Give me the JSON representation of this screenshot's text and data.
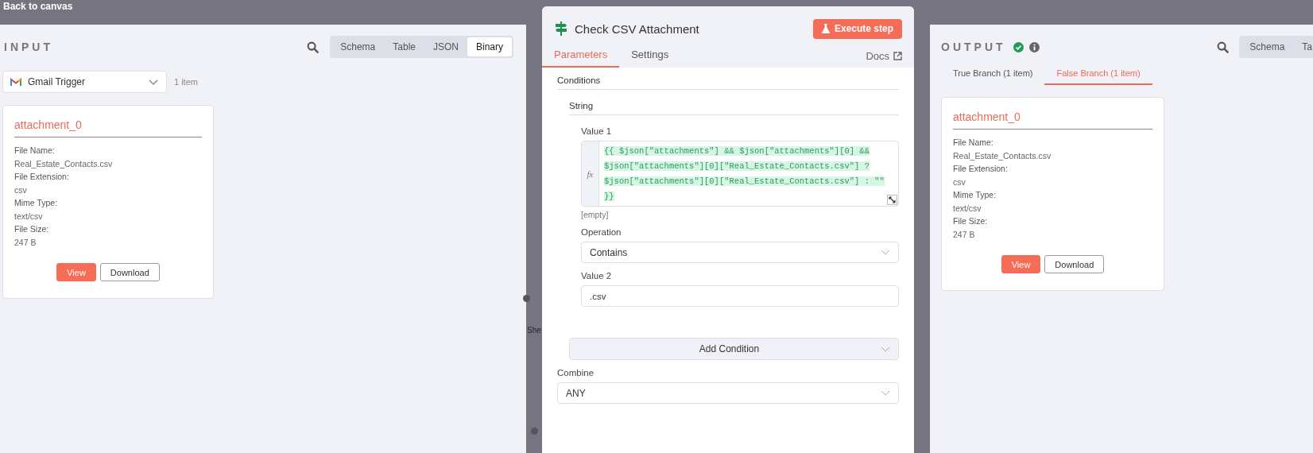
{
  "top_bar": {
    "back_link": "Back to canvas"
  },
  "input_panel": {
    "title": "INPUT",
    "view_tabs": [
      {
        "label": "Schema",
        "selected": false
      },
      {
        "label": "Table",
        "selected": false
      },
      {
        "label": "JSON",
        "selected": false
      },
      {
        "label": "Binary",
        "selected": true
      }
    ],
    "source_select": {
      "value": "Gmail Trigger"
    },
    "item_count": "1 item",
    "card": {
      "title": "attachment_0",
      "fields": [
        {
          "label": "File Name:",
          "value": "Real_Estate_Contacts.csv"
        },
        {
          "label": "File Extension:",
          "value": "csv"
        },
        {
          "label": "Mime Type:",
          "value": "text/csv"
        },
        {
          "label": "File Size:",
          "value": "247 B"
        }
      ],
      "buttons": [
        {
          "label": "View",
          "kind": "primary"
        },
        {
          "label": "Download",
          "kind": "secondary"
        }
      ]
    }
  },
  "canvas": {
    "node_label": "She"
  },
  "node_panel": {
    "title": "Check CSV Attachment",
    "execute_button": "Execute step",
    "tabs": [
      {
        "label": "Parameters",
        "selected": true
      },
      {
        "label": "Settings",
        "selected": false
      }
    ],
    "docs_link": "Docs",
    "conditions_label": "Conditions",
    "type_label": "String",
    "value1": {
      "label": "Value 1",
      "fx": "fx",
      "expression": "{{ $json[\"attachments\"] && $json[\"attachments\"][0] && $json[\"attachments\"][0][\"Real_Estate_Contacts.csv\"] ? $json[\"attachments\"][0][\"Real_Estate_Contacts.csv\"] : \"\" }}",
      "result": "[empty]"
    },
    "operation": {
      "label": "Operation",
      "value": "Contains"
    },
    "value2": {
      "label": "Value 2",
      "value": ".csv"
    },
    "add_condition": "Add Condition",
    "combine": {
      "label": "Combine",
      "value": "ANY"
    }
  },
  "output_panel": {
    "title": "OUTPUT",
    "view_tabs": [
      {
        "label": "Schema",
        "selected": false
      },
      {
        "label": "Ta",
        "selected": false
      }
    ],
    "branch_tabs": [
      {
        "label": "True Branch (1 item)",
        "selected": false
      },
      {
        "label": "False Branch (1 item)",
        "selected": true
      }
    ],
    "card": {
      "title": "attachment_0",
      "fields": [
        {
          "label": "File Name:",
          "value": "Real_Estate_Contacts.csv"
        },
        {
          "label": "File Extension:",
          "value": "csv"
        },
        {
          "label": "Mime Type:",
          "value": "text/csv"
        },
        {
          "label": "File Size:",
          "value": "247 B"
        }
      ],
      "buttons": [
        {
          "label": "View",
          "kind": "primary"
        },
        {
          "label": "Download",
          "kind": "secondary"
        }
      ]
    }
  }
}
